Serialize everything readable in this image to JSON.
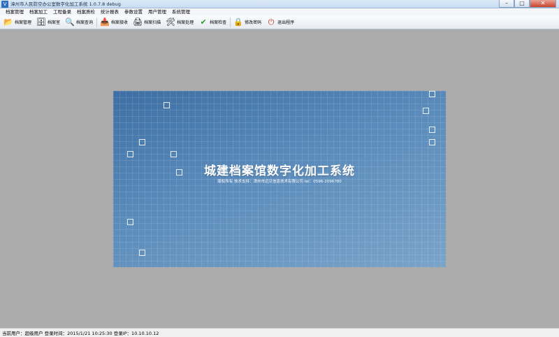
{
  "window": {
    "title": "漳州市人民防空办公室数字化加工系统 1.0.7.8 debug",
    "app_icon": "V",
    "minimize": "–",
    "maximize": "□",
    "close": "✕"
  },
  "menu": [
    "档案管理",
    "档案加工",
    "工程备录",
    "档案质检",
    "统计报表",
    "参数设置",
    "用户管理",
    "系统管理"
  ],
  "toolbar": [
    {
      "label": "档案管理",
      "icon": "folder-open-icon",
      "glyph": "📂"
    },
    {
      "label": "档案室",
      "icon": "cabinet-icon",
      "glyph": "🗄"
    },
    {
      "label": "档案查询",
      "icon": "search-document-icon",
      "glyph": "🔍"
    },
    {
      "label": "档案接收",
      "icon": "receive-icon",
      "glyph": "📥"
    },
    {
      "label": "档案扫描",
      "icon": "scanner-icon",
      "glyph": "🖨"
    },
    {
      "label": "档案处理",
      "icon": "process-icon",
      "glyph": "🛠"
    },
    {
      "label": "档案检查",
      "icon": "shield-check-icon",
      "glyph": "✔"
    },
    {
      "label": "修改密码",
      "icon": "lock-icon",
      "glyph": "🔒"
    },
    {
      "label": "退出程序",
      "icon": "power-icon",
      "glyph": "⏻"
    }
  ],
  "splash": {
    "title": "城建档案馆数字化加工系统",
    "subtitle": "版权所有  技术支持：漳州市迈贝信息技术有限公司  tel：0596-2096780"
  },
  "status": {
    "text": "当前用户：超级用户   登录时间：2015/1/21 10:25:30   登录IP：10.10.10.12"
  },
  "colors": {
    "splash_top": "#3e6fa4",
    "splash_bottom": "#7aa4c9",
    "workspace": "#ababab"
  }
}
